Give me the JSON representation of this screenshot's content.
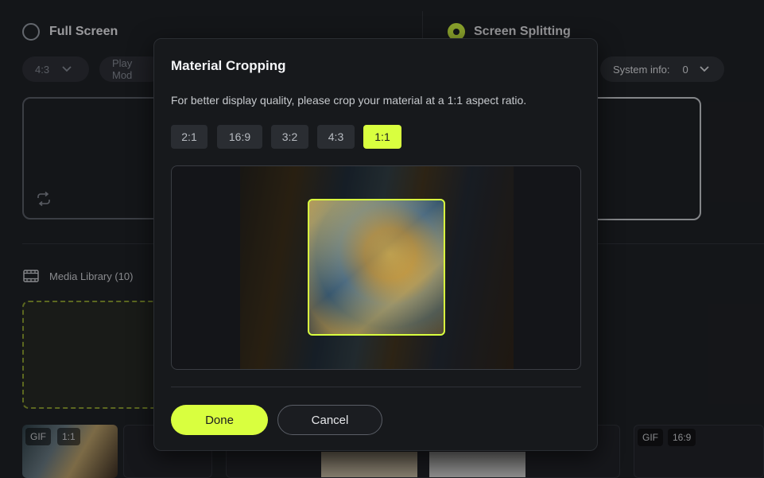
{
  "background": {
    "full_screen_label": "Full Screen",
    "screen_splitting_label": "Screen Splitting",
    "ratio_dropdown_value": "4:3",
    "play_mode_label": "Play Mod",
    "system_info_label": "System info:",
    "system_info_value": "0",
    "media_library_label": "Media Library (10)",
    "thumbnails": [
      {
        "type": "GIF",
        "ratio": "1:1"
      },
      {
        "type": "GIF",
        "ratio": "16:9"
      }
    ]
  },
  "modal": {
    "title": "Material Cropping",
    "description": "For better display quality, please crop your material at a 1:1 aspect ratio.",
    "ratios": [
      "2:1",
      "16:9",
      "3:2",
      "4:3",
      "1:1"
    ],
    "selected_ratio": "1:1",
    "done_label": "Done",
    "cancel_label": "Cancel"
  },
  "colors": {
    "accent": "#d9ff3f",
    "background": "#1b1d21",
    "modal_background": "#17191c"
  },
  "icons": {
    "radio_full_screen": "radio-unselected-icon",
    "radio_screen_splitting": "radio-selected-icon",
    "chevron": "chevron-down-icon",
    "repeat": "loop-icon",
    "film": "film-icon"
  }
}
